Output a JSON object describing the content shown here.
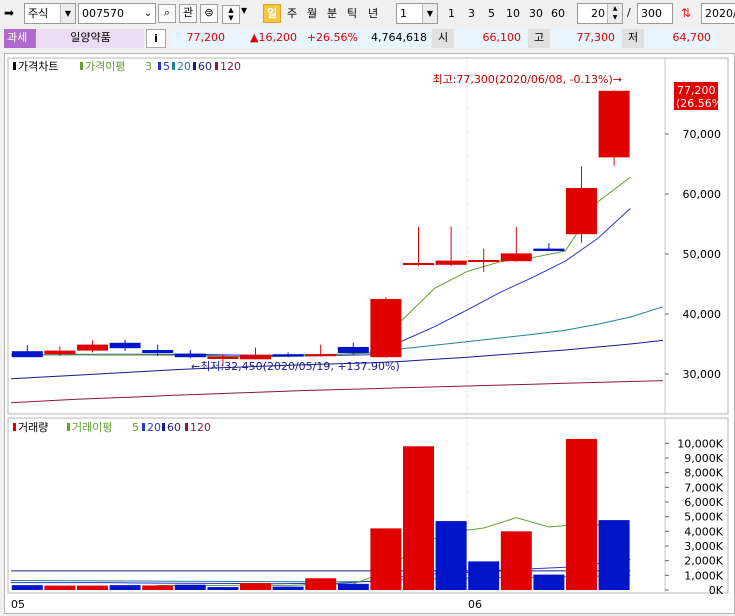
{
  "toolbar": {
    "market_type": "주식",
    "code": "007570",
    "watch_label": "관",
    "periods": [
      "일",
      "주",
      "월",
      "분",
      "틱",
      "년"
    ],
    "selected_period": "일",
    "interval": "1",
    "interval_shortcuts": [
      "1",
      "3",
      "5",
      "10",
      "30",
      "60"
    ],
    "view_count": "20",
    "total_count": "300",
    "date": "2020/"
  },
  "quote": {
    "tax_label": "과세",
    "name": "일양약품",
    "info_label": "i",
    "price": "77,200",
    "change": "▲16,200",
    "change_rate": "+26.56%",
    "volume": "4,764,618",
    "open_label": "시",
    "open": "66,100",
    "high_label": "고",
    "high": "77,300",
    "low_label": "저",
    "low": "64,700"
  },
  "price_panel": {
    "title": "가격차트",
    "ma_label": "가격이평",
    "ma_periods": [
      "3",
      "5",
      "20",
      "60",
      "120"
    ],
    "current_price": "77,200",
    "current_rate": "(26.56%)",
    "high_annotation": "최고:77,300(2020/06/08, -0.13%)→",
    "low_annotation": "←최저:32,450(2020/05/19, +137.90%)",
    "y_ticks": [
      "70,000",
      "60,000",
      "50,000",
      "40,000",
      "30,000"
    ]
  },
  "volume_panel": {
    "title": "거래량",
    "ma_label": "거래이평",
    "ma_periods": [
      "5",
      "20",
      "60",
      "120"
    ],
    "y_ticks": [
      "10,000K",
      "9,000K",
      "8,000K",
      "7,000K",
      "6,000K",
      "5,000K",
      "4,000K",
      "3,000K",
      "2,000K",
      "1,000K",
      "0K"
    ]
  },
  "x_labels": [
    "05",
    "06"
  ],
  "colors": {
    "up": "#e00000",
    "down": "#0014c8",
    "ma3": "#66a032",
    "ma5": "#2a36d0",
    "ma20": "#20809a",
    "ma60": "#1a1a8a",
    "ma120": "#8a1a3a"
  },
  "chart_data": [
    {
      "type": "candlestick",
      "title": "가격차트",
      "ylim": [
        24000,
        80000
      ],
      "candles": [
        {
          "o": 33800,
          "h": 34800,
          "l": 32900,
          "c": 32800
        },
        {
          "o": 33300,
          "h": 34600,
          "l": 33000,
          "c": 33900
        },
        {
          "o": 33900,
          "h": 35600,
          "l": 33600,
          "c": 34900
        },
        {
          "o": 35200,
          "h": 35700,
          "l": 33900,
          "c": 34300
        },
        {
          "o": 34000,
          "h": 34900,
          "l": 33000,
          "c": 33500
        },
        {
          "o": 33400,
          "h": 34000,
          "l": 32600,
          "c": 32800
        },
        {
          "o": 32500,
          "h": 33300,
          "l": 31300,
          "c": 32900
        },
        {
          "o": 32450,
          "h": 34400,
          "l": 32450,
          "c": 33200
        },
        {
          "o": 33300,
          "h": 33600,
          "l": 32800,
          "c": 32900
        },
        {
          "o": 33100,
          "h": 34900,
          "l": 32900,
          "c": 33300
        },
        {
          "o": 34500,
          "h": 35200,
          "l": 33300,
          "c": 33500
        },
        {
          "o": 32800,
          "h": 42800,
          "l": 32700,
          "c": 42500
        },
        {
          "o": 48300,
          "h": 54500,
          "l": 48000,
          "c": 48500
        },
        {
          "o": 48200,
          "h": 54600,
          "l": 48000,
          "c": 48900
        },
        {
          "o": 49000,
          "h": 50900,
          "l": 47000,
          "c": 49000
        },
        {
          "o": 48800,
          "h": 54500,
          "l": 48700,
          "c": 50100
        },
        {
          "o": 50900,
          "h": 51800,
          "l": 50600,
          "c": 50500
        },
        {
          "o": 53300,
          "h": 64600,
          "l": 51900,
          "c": 61000
        },
        {
          "o": 66100,
          "h": 77300,
          "l": 64700,
          "c": 77200
        }
      ],
      "ma3": [
        33200,
        33250,
        33300,
        33280,
        33200,
        33150,
        33000,
        32900,
        32900,
        33000,
        33200,
        33500,
        39000,
        44300,
        47100,
        48700,
        49400,
        50500,
        58700,
        62800
      ],
      "ma5": [
        null,
        33200,
        33250,
        33300,
        33300,
        33300,
        33250,
        33150,
        33050,
        33000,
        33100,
        33200,
        35500,
        37900,
        40700,
        43600,
        46100,
        48800,
        52600,
        57600
      ],
      "ma20": [
        33200,
        33200,
        33180,
        33170,
        33160,
        33150,
        33150,
        33150,
        33150,
        33200,
        33300,
        33500,
        34200,
        34800,
        35400,
        36000,
        36600,
        37300,
        38300,
        39500,
        41200
      ],
      "ma60": [
        29200,
        29500,
        29800,
        30100,
        30400,
        30700,
        30950,
        31150,
        31350,
        31550,
        31700,
        31850,
        32100,
        32450,
        32800,
        33200,
        33600,
        34000,
        34500,
        35000,
        35600
      ],
      "ma120": [
        25200,
        25500,
        25800,
        26000,
        26200,
        26450,
        26650,
        26850,
        27050,
        27250,
        27400,
        27550,
        27700,
        27850,
        28000,
        28150,
        28300,
        28450,
        28600,
        28750,
        28900
      ]
    },
    {
      "type": "bar",
      "title": "거래량",
      "unit": "K",
      "ylim": [
        0,
        10500
      ],
      "values": [
        330,
        300,
        300,
        330,
        310,
        360,
        200,
        470,
        230,
        800,
        420,
        4200,
        9800,
        4700,
        1950,
        4000,
        1050,
        10300,
        4765
      ],
      "up": [
        false,
        true,
        true,
        false,
        true,
        false,
        false,
        true,
        false,
        true,
        false,
        true,
        true,
        false,
        false,
        true,
        false,
        true,
        false
      ],
      "ma5": [
        null,
        null,
        null,
        null,
        310,
        310,
        310,
        330,
        300,
        410,
        420,
        1230,
        3110,
        3930,
        4230,
        4930,
        4300,
        4480,
        4410
      ],
      "ma20": [
        500,
        500,
        500,
        500,
        480,
        460,
        450,
        440,
        430,
        440,
        450,
        600,
        900,
        1100,
        1200,
        1350,
        1450,
        1550,
        1800,
        2100
      ],
      "ma60": [
        650,
        640,
        630,
        620,
        610,
        600,
        590,
        580,
        570,
        560,
        560,
        580,
        700,
        760,
        800,
        840,
        870,
        900,
        950,
        1000
      ],
      "ma120": [
        1300,
        1300,
        1300,
        1300,
        1300,
        1300,
        1300,
        1300,
        1300,
        1300,
        1300,
        1300,
        1300,
        1300,
        1300,
        1300,
        1300,
        1300,
        1300,
        1300
      ]
    }
  ]
}
